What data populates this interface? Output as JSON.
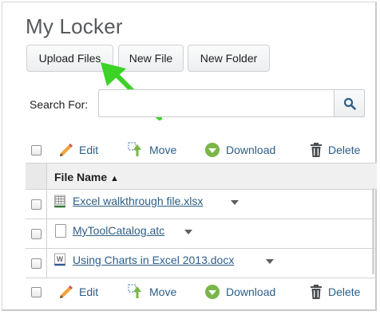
{
  "page": {
    "title": "My Locker"
  },
  "buttons": {
    "upload": "Upload Files",
    "new_file": "New File",
    "new_folder": "New Folder"
  },
  "search": {
    "label": "Search For:",
    "value": "",
    "placeholder": ""
  },
  "actions": {
    "edit": "Edit",
    "move": "Move",
    "download": "Download",
    "delete": "Delete"
  },
  "table": {
    "column": "File Name",
    "sort_indicator": "▲",
    "rows": [
      {
        "name": "Excel walkthrough file.xlsx",
        "icon": "spreadsheet-file-icon"
      },
      {
        "name": "MyToolCatalog.atc",
        "icon": "generic-file-icon"
      },
      {
        "name": "Using Charts in Excel 2013.docx",
        "icon": "word-file-icon"
      }
    ]
  },
  "colors": {
    "link": "#2d5e88",
    "arrow": "#3bd326",
    "download_green": "#7ab648",
    "title": "#565a5c"
  }
}
